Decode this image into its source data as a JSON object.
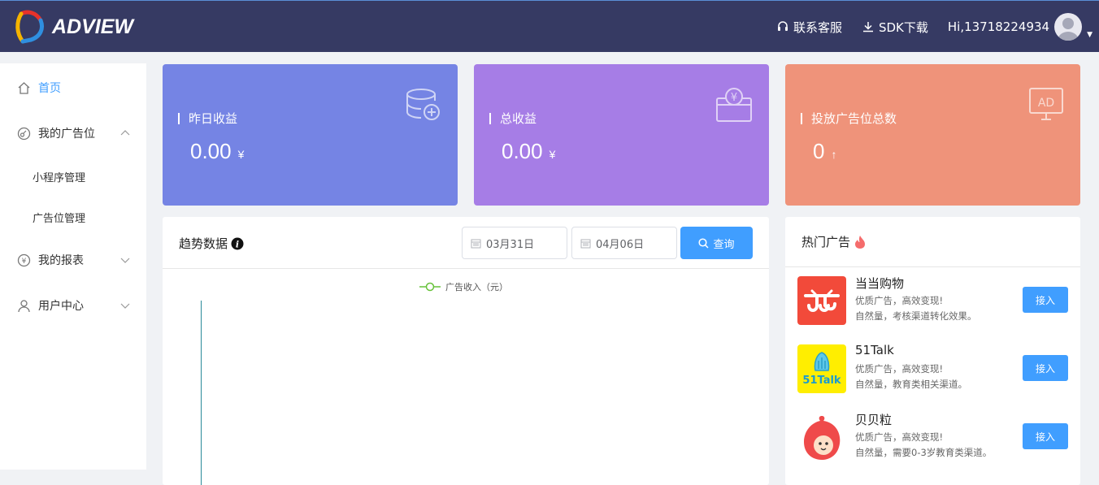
{
  "header": {
    "logo_text": "ADVIEW",
    "support_label": "联系客服",
    "sdk_label": "SDK下载",
    "greeting": "Hi,13718224934"
  },
  "sidebar": {
    "items": [
      {
        "label": "首页",
        "icon": "home-icon",
        "active": true
      },
      {
        "label": "我的广告位",
        "icon": "ad-slot-icon",
        "expanded": true
      },
      {
        "label": "小程序管理",
        "sub": true
      },
      {
        "label": "广告位管理",
        "sub": true
      },
      {
        "label": "我的报表",
        "icon": "yen-icon"
      },
      {
        "label": "用户中心",
        "icon": "user-icon"
      }
    ]
  },
  "cards": [
    {
      "label": "昨日收益",
      "value": "0.00",
      "unit": "¥",
      "color": "#7584e4",
      "icon": "coins-plus-icon"
    },
    {
      "label": "总收益",
      "value": "0.00",
      "unit": "¥",
      "color": "#a67de6",
      "icon": "money-box-icon"
    },
    {
      "label": "投放广告位总数",
      "value": "0",
      "unit": "↑",
      "color": "#ef937a",
      "icon": "ad-screen-icon"
    }
  ],
  "trend": {
    "title": "趋势数据",
    "start_date": "03月31日",
    "end_date": "04月06日",
    "query_label": "查询",
    "legend": "广告收入（元）"
  },
  "chart_data": {
    "type": "line",
    "series": [
      {
        "name": "广告收入（元）",
        "values": []
      }
    ],
    "categories": []
  },
  "hot": {
    "title": "热门广告",
    "items": [
      {
        "name": "当当购物",
        "desc1": "优质广告，高效变现!",
        "desc2": "自然量，考核渠道转化效果。",
        "btn": "接入"
      },
      {
        "name": "51Talk",
        "desc1": "优质广告，高效变现!",
        "desc2": "自然量，教育类相关渠道。",
        "btn": "接入"
      },
      {
        "name": "贝贝粒",
        "desc1": "优质广告，高效变现!",
        "desc2": "自然量，需要0-3岁教育类渠道。",
        "btn": "接入"
      }
    ]
  },
  "colors": {
    "header_bg": "#363a63",
    "accent": "#409eff"
  }
}
